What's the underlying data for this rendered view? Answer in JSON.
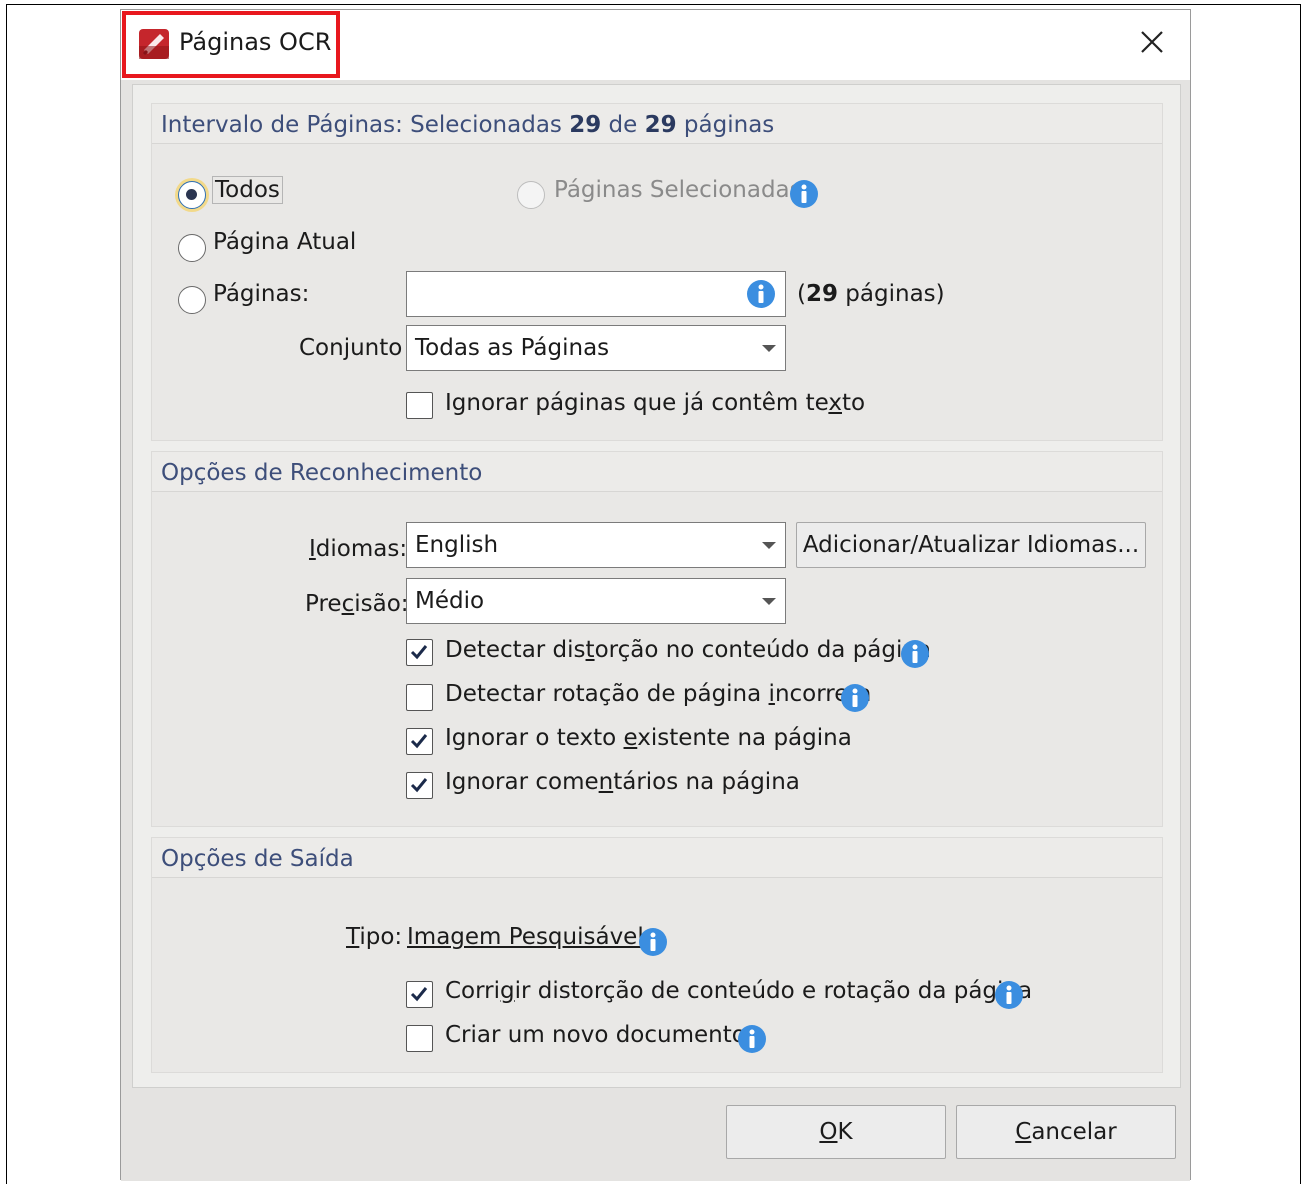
{
  "dialog": {
    "title": "Páginas OCR",
    "close_label": "×"
  },
  "page_range": {
    "header_prefix": "Intervalo de Páginas: Selecionadas ",
    "selected": "29",
    "header_mid": " de ",
    "total": "29",
    "header_suffix": " páginas",
    "radio_all": "Todos",
    "radio_selected_pages": "Páginas Selecionadas",
    "radio_current": "Página Atual",
    "radio_pages": "Páginas:",
    "pages_input_value": "",
    "pages_count_open": "(",
    "pages_count_num": "29",
    "pages_count_rest": " páginas)",
    "set_label": "Conjunto",
    "set_value": "Todas as Páginas",
    "ignore_text_pages_pre": "Ignorar páginas que já contêm te",
    "ignore_text_pages_u": "x",
    "ignore_text_pages_post": "to",
    "ignore_text_pages_checked": false
  },
  "recognition": {
    "header": "Opções de Reconhecimento",
    "languages_u": "I",
    "languages_rest": "diomas:",
    "languages_value": "English",
    "add_languages_button": "Adicionar/Atualizar Idiomas...",
    "precision_pre": "Pre",
    "precision_u": "c",
    "precision_post": "isão:",
    "precision_value": "Médio",
    "detect_distortion_pre": "Detectar dis",
    "detect_distortion_u": "t",
    "detect_distortion_post": "orção no conteúdo da página",
    "detect_distortion_checked": true,
    "detect_rotation_pre": "Detectar rotação de página ",
    "detect_rotation_u": "i",
    "detect_rotation_post": "ncorreta",
    "detect_rotation_checked": false,
    "ignore_existing_pre": "Ignorar o texto ",
    "ignore_existing_u": "e",
    "ignore_existing_post": "xistente na página",
    "ignore_existing_checked": true,
    "ignore_comments_pre": "Ignorar come",
    "ignore_comments_u": "n",
    "ignore_comments_post": "tários na página",
    "ignore_comments_checked": true
  },
  "output": {
    "header": "Opções de Saída",
    "type_u": "T",
    "type_rest": "ipo:",
    "type_value": "Imagem Pesquisável",
    "fix_distortion_pre": "Corri",
    "fix_distortion_u": "g",
    "fix_distortion_post": "ir distorção de conteúdo e rotação da página",
    "fix_distortion_checked": true,
    "new_document": "Criar um novo documento",
    "new_document_checked": false
  },
  "footer": {
    "ok_u": "O",
    "ok_rest": "K",
    "cancel_u": "C",
    "cancel_rest": "ancelar"
  },
  "colors": {
    "accent": "#2e6fb5",
    "info": "#3b8ee0",
    "highlight": "#e8181e",
    "header_text": "#3d4e7a"
  }
}
